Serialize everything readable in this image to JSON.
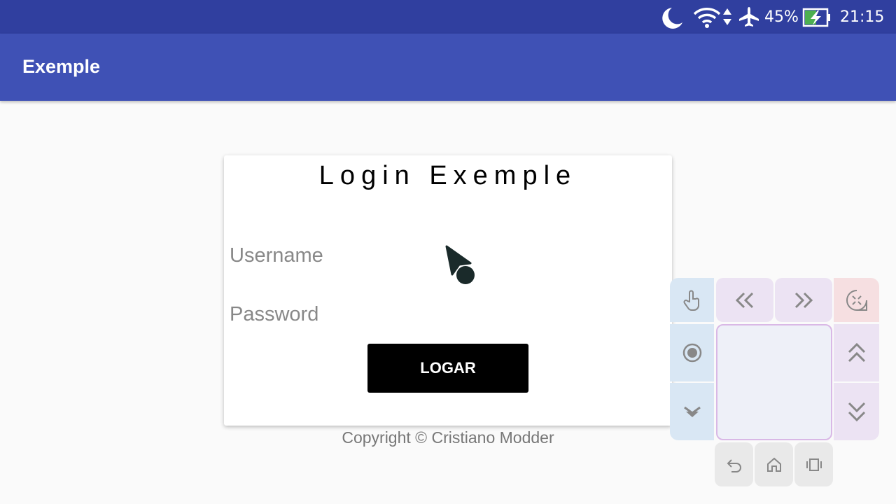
{
  "status_bar": {
    "battery_percent": "45%",
    "time": "21:15",
    "icons": [
      "moon-icon",
      "wifi-icon",
      "data-arrows-icon",
      "airplane-icon",
      "battery-charging-icon"
    ]
  },
  "app_bar": {
    "title": "Exemple"
  },
  "login_card": {
    "title": "Login Exemple",
    "username_placeholder": "Username",
    "password_placeholder": "Password",
    "button_label": "LOGAR"
  },
  "footer": {
    "copyright": "Copyright © Cristiano Modder"
  },
  "overlay_controls": {
    "icons": [
      "hand-icon",
      "rewind-icon",
      "fast-forward-icon",
      "collapse-icon",
      "record-icon",
      "scroll-up-icon",
      "dropdown-icon",
      "scroll-down-icon",
      "back-icon",
      "home-icon",
      "recents-icon"
    ]
  },
  "colors": {
    "status_bar": "#303f9f",
    "app_bar": "#3f51b5",
    "button": "#000000"
  }
}
